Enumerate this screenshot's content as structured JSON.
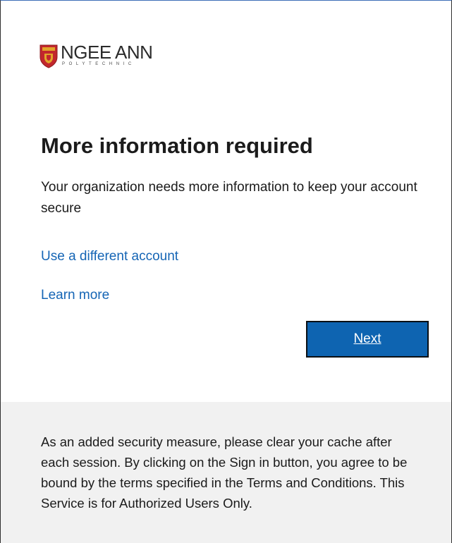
{
  "organization": {
    "logo_name": "NGEE ANN",
    "logo_subtitle": "POLYTECHNIC",
    "colors": {
      "shield_red": "#c2272d",
      "shield_gold": "#e2a52a"
    }
  },
  "main": {
    "heading": "More information required",
    "description": "Your organization needs more information to keep your account secure",
    "links": {
      "different_account": "Use a different account",
      "learn_more": "Learn more"
    },
    "next_button": "Next"
  },
  "footer": {
    "notice": "As an added security measure, please clear your cache after each session. By clicking on the Sign in button, you agree to be bound by the terms specified in the Terms and Conditions. This Service is for Authorized Users Only."
  },
  "colors": {
    "accent": "#0e64b1",
    "link": "#1565b5",
    "footer_bg": "#f1f1f1"
  }
}
